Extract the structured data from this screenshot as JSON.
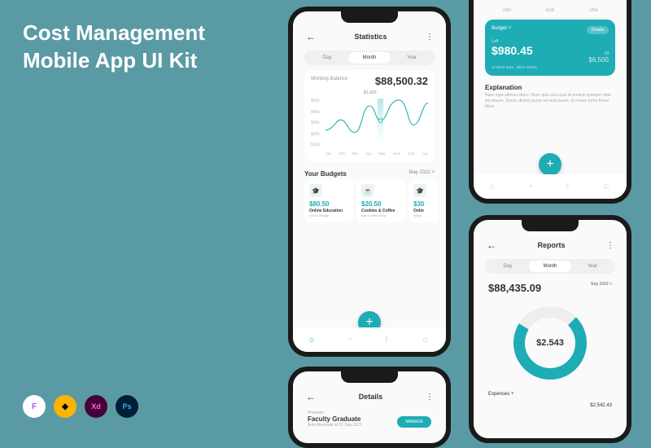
{
  "title_line1": "Cost Management",
  "title_line2": "Mobile App UI Kit",
  "tools": {
    "figma": "F",
    "sketch": "◆",
    "xd": "Xd",
    "ps": "Ps"
  },
  "stats": {
    "title": "Statistics",
    "tabs": {
      "day": "Day",
      "month": "Month",
      "year": "Year"
    },
    "working_balance_label": "Working Balance",
    "working_balance": "$88,500.32",
    "delta": "-$1,423",
    "y_ticks": [
      "$50k",
      "$40k",
      "$30k",
      "$20k",
      "$10k"
    ],
    "x_ticks": [
      "Jan",
      "Feb",
      "Mar",
      "Apr",
      "May",
      "June",
      "July",
      "Aug"
    ],
    "budgets_title": "Your Budgets",
    "budgets_month": "May 2022",
    "budgets": [
      {
        "icon": "🎓",
        "amount": "$80.50",
        "name": "Online Education",
        "sub": "UI/UX Design"
      },
      {
        "icon": "☕",
        "amount": "$20.50",
        "name": "Cookies & Coffee",
        "sub": "Star Coffee Shop"
      },
      {
        "icon": "🎓",
        "amount": "$30",
        "name": "Onlin",
        "sub": "Witch"
      }
    ]
  },
  "budget_card": {
    "currencies": [
      "USD",
      "EUR",
      "USA"
    ],
    "label": "Budget",
    "details": "Details",
    "left_label": "Left",
    "left_amount": "$980.45",
    "of_label": "Of",
    "of_amount": "$6,500",
    "footnote": "12 More days · $221.43/day",
    "exp_title": "Explanation",
    "exp_text": "Nunc eget ultrices libero. Nunc quis arcu quis at pretium quisque vitae ies mauris. Donec dictum purus vel erat ipsum, et ornare tortor Read More."
  },
  "reports": {
    "title": "Reports",
    "tabs": {
      "day": "Day",
      "month": "Month",
      "year": "Year"
    },
    "amount": "$88,435.09",
    "period": "Sep 2022",
    "donut_value": "$2.543",
    "expenses_label": "Expenses",
    "expenses_value": "$2,542.43"
  },
  "details": {
    "title": "Details",
    "premium": "Premium",
    "name": "Faculty Graduate",
    "renewal": "Auto-Renewal at 01 Sep.2022",
    "manage": "MANAGE"
  },
  "chart_data": {
    "type": "line",
    "title": "Working Balance",
    "xlabel": "",
    "ylabel": "",
    "ylim": [
      0,
      50000
    ],
    "categories": [
      "Jan",
      "Feb",
      "Mar",
      "Apr",
      "May",
      "June",
      "July",
      "Aug"
    ],
    "values": [
      14000,
      26000,
      12000,
      42000,
      25000,
      48000,
      20000,
      45000
    ],
    "highlight_index": 4,
    "highlight_delta": -1423
  }
}
